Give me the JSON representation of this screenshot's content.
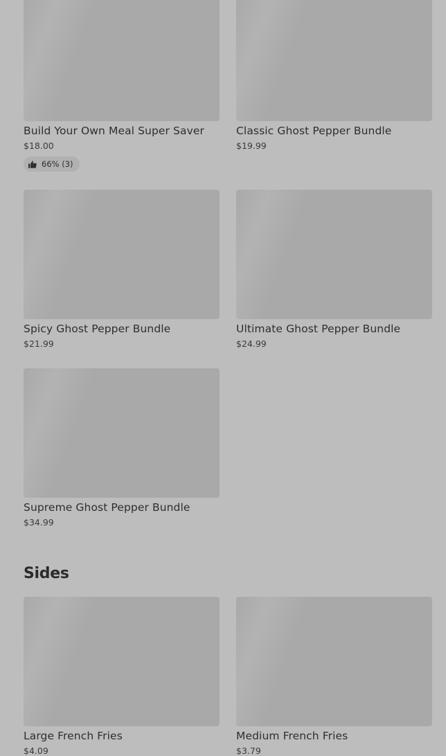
{
  "items_top": [
    {
      "name": "Build Your Own Meal Super Saver",
      "price": "$18.00",
      "rating": "66% (3)"
    },
    {
      "name": "Classic Ghost Pepper Bundle",
      "price": "$19.99"
    },
    {
      "name": "Spicy Ghost Pepper Bundle",
      "price": "$21.99"
    },
    {
      "name": "Ultimate Ghost Pepper Bundle",
      "price": "$24.99"
    },
    {
      "name": "Supreme Ghost Pepper Bundle",
      "price": "$34.99"
    }
  ],
  "sides": {
    "title": "Sides",
    "items": [
      {
        "name": "Large French Fries",
        "price": "$4.09"
      },
      {
        "name": "Medium French Fries",
        "price": "$3.79"
      }
    ]
  },
  "icons": {
    "rating": "thumbs-up-icon"
  }
}
